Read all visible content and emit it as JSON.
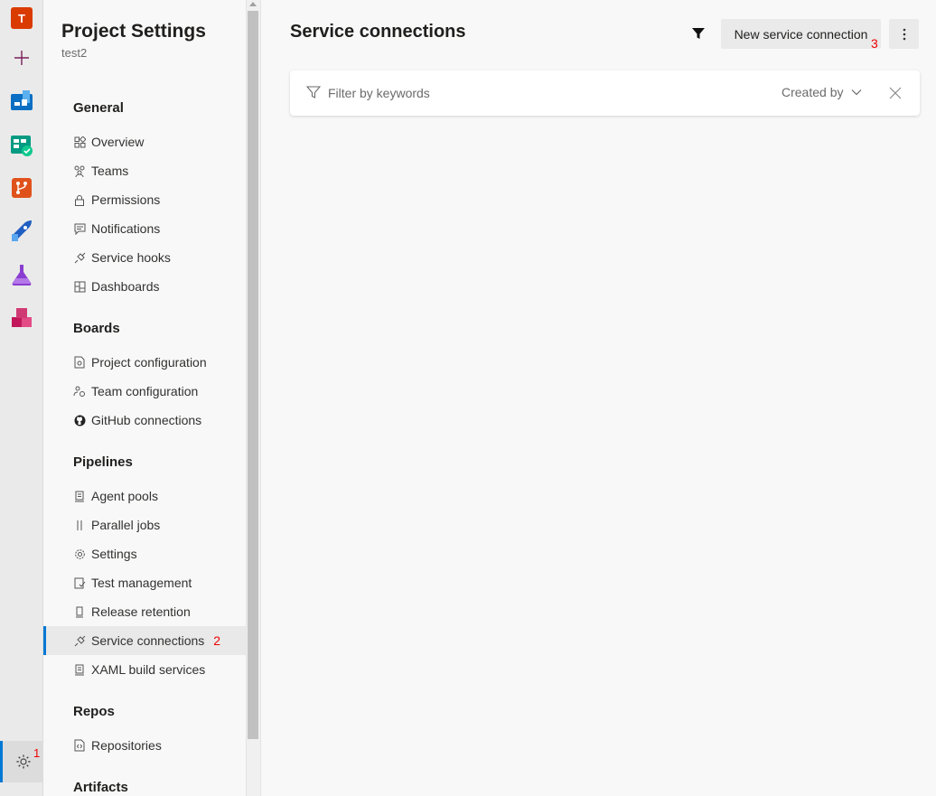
{
  "rail": {
    "avatar_letter": "T",
    "settings_marker": "1"
  },
  "nav": {
    "title": "Project Settings",
    "subtitle": "test2",
    "sections": {
      "general": "General",
      "boards": "Boards",
      "pipelines": "Pipelines",
      "repos": "Repos",
      "artifacts": "Artifacts"
    },
    "items": {
      "overview": "Overview",
      "teams": "Teams",
      "permissions": "Permissions",
      "notifications": "Notifications",
      "service_hooks": "Service hooks",
      "dashboards": "Dashboards",
      "project_configuration": "Project configuration",
      "team_configuration": "Team configuration",
      "github_connections": "GitHub connections",
      "agent_pools": "Agent pools",
      "parallel_jobs": "Parallel jobs",
      "settings": "Settings",
      "test_management": "Test management",
      "release_retention": "Release retention",
      "service_connections": "Service connections",
      "xaml_build_services": "XAML build services",
      "repositories": "Repositories"
    },
    "active_marker": "2"
  },
  "main": {
    "title": "Service connections",
    "new_button_label": "New service connection",
    "new_button_marker": "3",
    "filter_placeholder": "Filter by keywords",
    "created_by_label": "Created by"
  },
  "colors": {
    "accent": "#0078d4",
    "avatar": "#da3b01",
    "marker": "#e00000"
  }
}
